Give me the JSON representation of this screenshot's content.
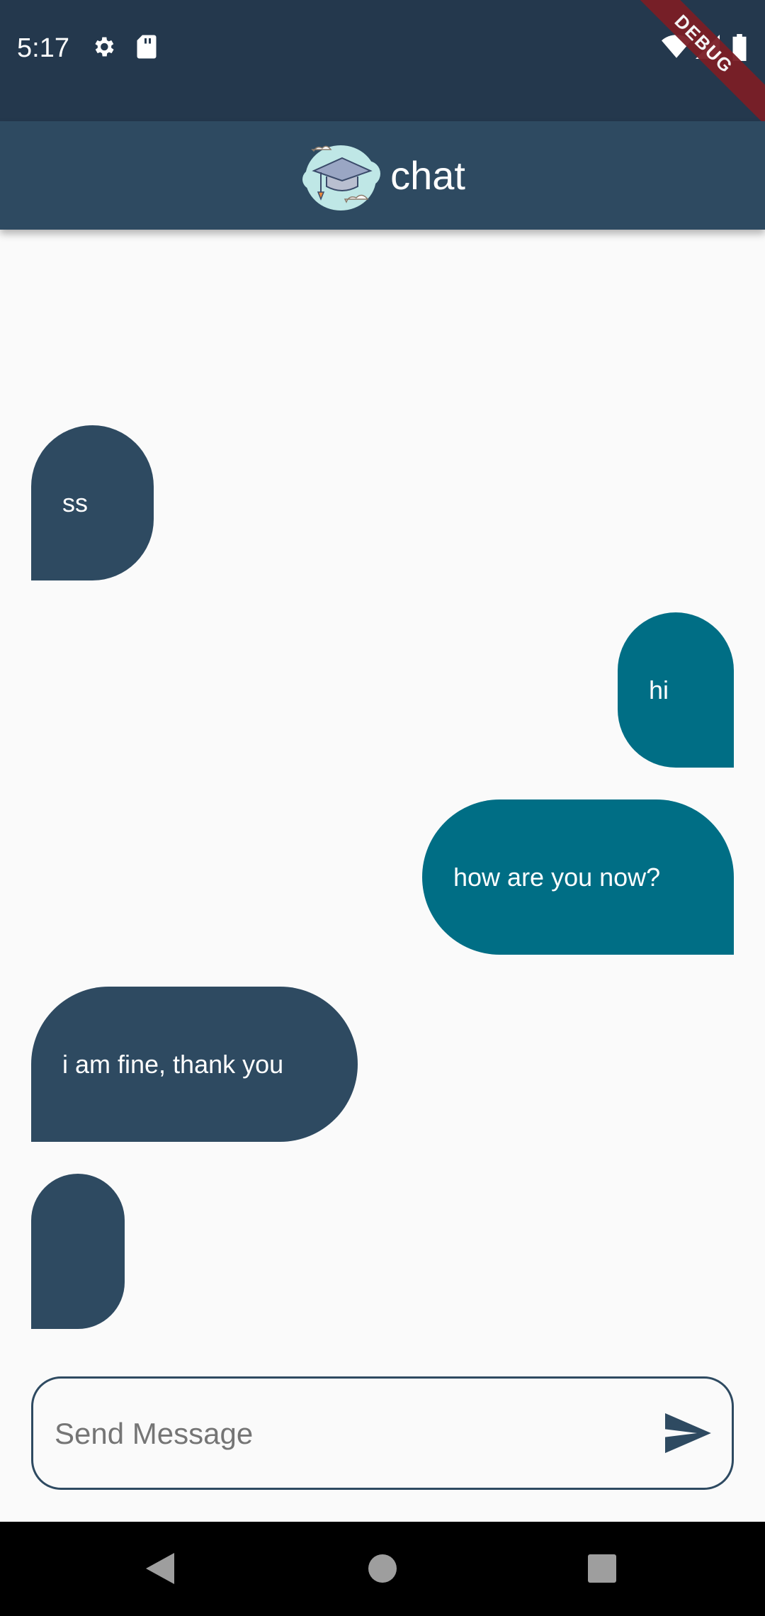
{
  "status_bar": {
    "time": "5:17",
    "debug_banner": "DEBUG",
    "icons": [
      "settings-icon",
      "sd-card-icon",
      "wifi-icon",
      "signal-icon",
      "battery-icon"
    ]
  },
  "app_bar": {
    "logo_icon": "graduation-cap-cloud-icon",
    "title": "chat",
    "background": "#2e4a61"
  },
  "messages": [
    {
      "side": "left",
      "text": "ss"
    },
    {
      "side": "right",
      "text": "hi"
    },
    {
      "side": "right",
      "text": "how are you now?"
    },
    {
      "side": "left",
      "text": "i am fine, thank you"
    },
    {
      "side": "left",
      "text": ""
    }
  ],
  "composer": {
    "placeholder": "Send Message",
    "value": "",
    "send_icon": "send-icon"
  },
  "colors": {
    "incoming_bubble": "#2e4a61",
    "outgoing_bubble": "#006e85",
    "status_bar": "#24384d"
  },
  "nav_bar": {
    "icons": [
      "back-icon",
      "home-icon",
      "recents-icon"
    ]
  }
}
